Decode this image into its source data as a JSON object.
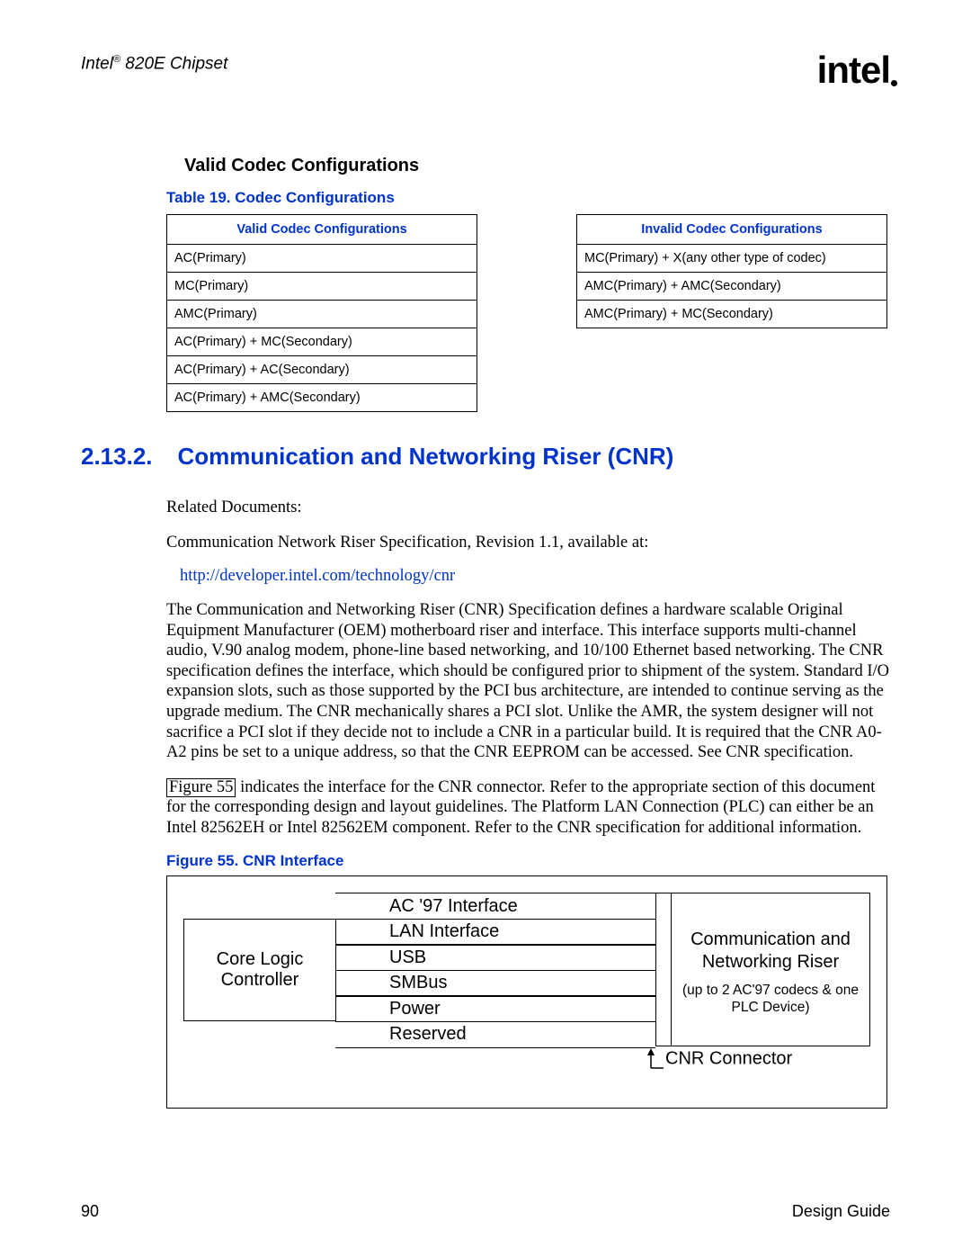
{
  "header": {
    "chipset_prefix": "Intel",
    "chipset_reg": "®",
    "chipset_suffix": " 820E Chipset",
    "logo_text": "intel"
  },
  "subhead": "Valid Codec Configurations",
  "table_caption": "Table 19. Codec Configurations",
  "valid_table": {
    "header": "Valid Codec Configurations",
    "rows": [
      "AC(Primary)",
      "MC(Primary)",
      "AMC(Primary)",
      "AC(Primary) + MC(Secondary)",
      "AC(Primary) + AC(Secondary)",
      "AC(Primary) + AMC(Secondary)"
    ]
  },
  "invalid_table": {
    "header": "Invalid Codec Configurations",
    "rows": [
      "MC(Primary) + X(any other type of codec)",
      "AMC(Primary) + AMC(Secondary)",
      "AMC(Primary) + MC(Secondary)"
    ]
  },
  "section": {
    "number": "2.13.2.",
    "title": "Communication and Networking Riser (CNR)"
  },
  "body": {
    "related": "Related Documents:",
    "spec_line": "Communication Network Riser Specification, Revision 1.1, available at:",
    "link": "http://developer.intel.com/technology/cnr",
    "para1": "The Communication and Networking Riser (CNR) Specification defines a hardware scalable Original Equipment Manufacturer (OEM) motherboard riser and interface.  This interface supports multi-channel audio, V.90 analog modem, phone-line based networking, and 10/100 Ethernet based networking.  The CNR specification defines the interface, which should be configured prior to shipment of the system.  Standard I/O expansion slots, such as those supported by the PCI bus architecture, are intended to continue serving as the upgrade medium.  The CNR mechanically shares a PCI slot.  Unlike the AMR, the system designer will not sacrifice a PCI slot if they decide not to include a CNR in a particular build.  It is required that the CNR A0-A2 pins be set to a unique address, so that the CNR EEPROM can be accessed.  See CNR specification.",
    "figref": "Figure 55",
    "para2_rest": " indicates the interface for the CNR connector.  Refer to the appropriate section of this document for the corresponding design and layout guidelines.  The Platform LAN Connection (PLC) can either be an Intel 82562EH or Intel 82562EM component.  Refer to the CNR specification for additional information."
  },
  "figure_caption": "Figure 55. CNR Interface",
  "diagram": {
    "left": "Core Logic Controller",
    "rows": [
      "AC '97 Interface",
      "LAN Interface",
      "USB",
      "SMBus",
      "Power",
      "Reserved"
    ],
    "right_big": "Communication and Networking Riser",
    "right_small": "(up to 2 AC'97 codecs & one PLC Device)",
    "connector_label": "CNR Connector"
  },
  "footer": {
    "page": "90",
    "doc": "Design Guide"
  }
}
